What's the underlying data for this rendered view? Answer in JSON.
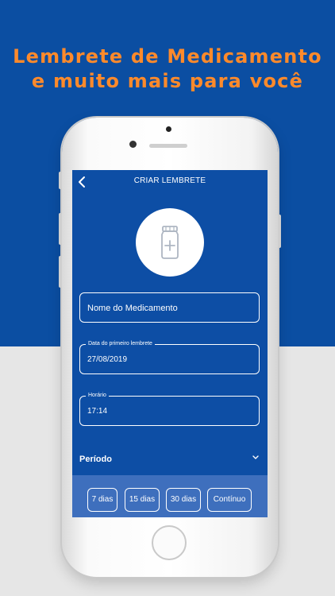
{
  "banner": {
    "line1": "Lembrete de Medicamento",
    "line2": "e muito mais para você"
  },
  "colors": {
    "brand_blue": "#0b4ea2",
    "accent_orange": "#ff8a2b",
    "bottom_bar": "#3e6fbd"
  },
  "screen": {
    "title": "CRIAR LEMBRETE",
    "icons": {
      "back": "chevron-left-icon",
      "avatar": "medicine-bottle-icon",
      "expand": "chevron-down-icon"
    },
    "form": {
      "medicine_name_placeholder": "Nome do Medicamento",
      "first_reminder_label": "Data do primeiro lembrete",
      "first_reminder_value": "27/08/2019",
      "time_label": "Horário",
      "time_value": "17:14"
    },
    "period": {
      "label": "Período",
      "options": [
        "7 dias",
        "15 dias",
        "30 dias",
        "Contínuo"
      ]
    }
  }
}
